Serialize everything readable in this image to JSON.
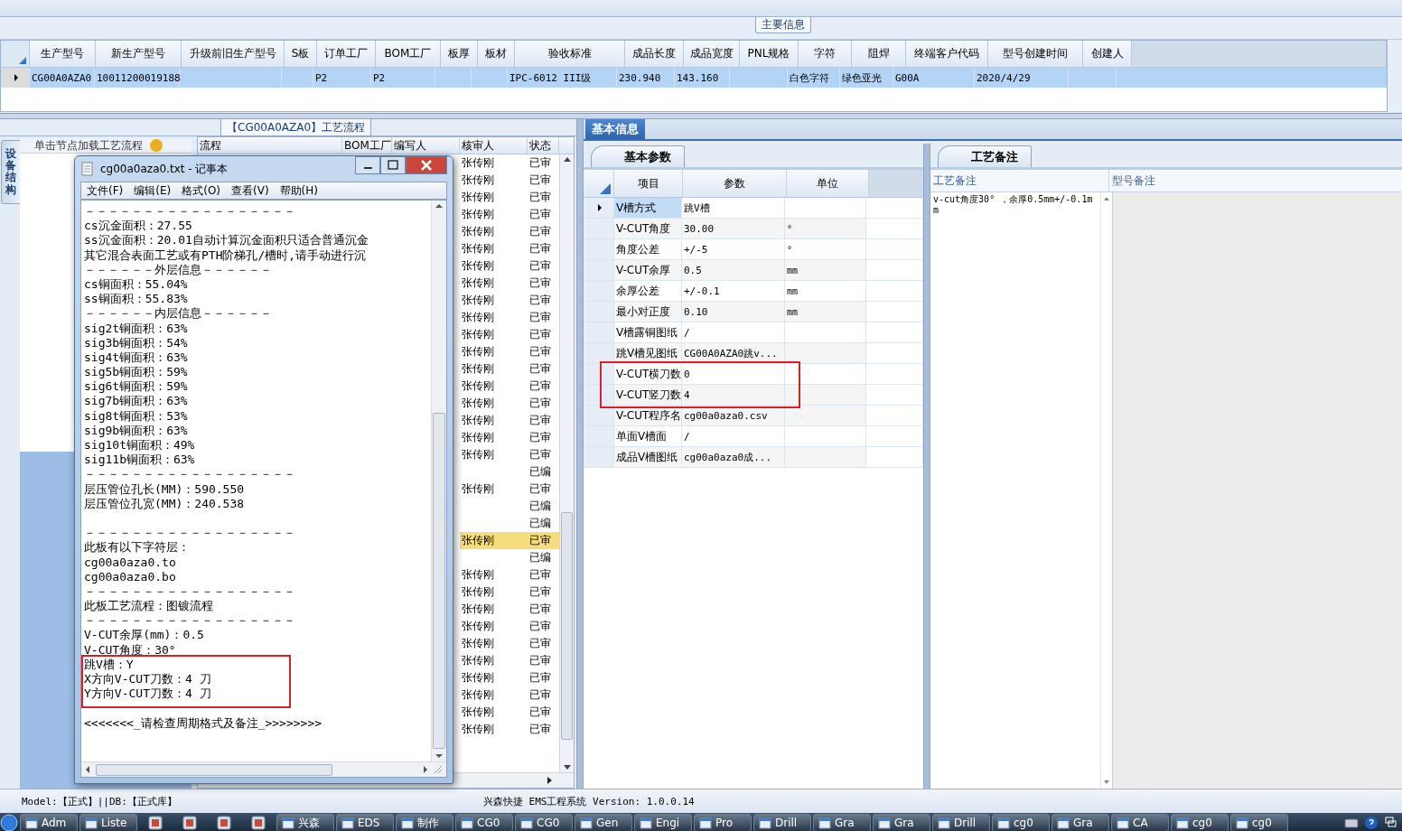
{
  "main_info": {
    "title": "主要信息",
    "columns": [
      "生产型号",
      "新生产型号",
      "升级前旧生产型号",
      "S板",
      "订单工厂",
      "BOM工厂",
      "板厚",
      "板材",
      "验收标准",
      "成品长度",
      "成品宽度",
      "PNL规格",
      "字符",
      "阻焊",
      "终端客户代码",
      "型号创建时间",
      "创建人"
    ],
    "rows": [
      {
        "selected": true,
        "cells": [
          "CG00A0AZA0",
          "10011200019188",
          null,
          null,
          "P2",
          "P2",
          null,
          null,
          "IPC-6012 III级",
          "230.940",
          "143.160",
          null,
          "白色字符",
          "绿色亚光",
          "G00A",
          "2020/4/29",
          null
        ]
      }
    ]
  },
  "flow_panel": {
    "title": "【CG00A0AZA0】工艺流程",
    "side_tab": "设备结构",
    "tree_hint": "单击节点加载工艺流程",
    "columns": [
      "流程",
      "BOM工厂",
      "编写人",
      "核审人",
      "状态"
    ],
    "rows": [
      {
        "reviewer": "张传刚",
        "status": "已审",
        "selected": false
      },
      {
        "reviewer": "张传刚",
        "status": "已审",
        "selected": false
      },
      {
        "reviewer": "张传刚",
        "status": "已审",
        "selected": false
      },
      {
        "reviewer": "张传刚",
        "status": "已审",
        "selected": false
      },
      {
        "reviewer": "张传刚",
        "status": "已审",
        "selected": false
      },
      {
        "reviewer": "张传刚",
        "status": "已审",
        "selected": false
      },
      {
        "reviewer": "张传刚",
        "status": "已审",
        "selected": false
      },
      {
        "reviewer": "张传刚",
        "status": "已审",
        "selected": false
      },
      {
        "reviewer": "张传刚",
        "status": "已审",
        "selected": false
      },
      {
        "reviewer": "张传刚",
        "status": "已审",
        "selected": false
      },
      {
        "reviewer": "张传刚",
        "status": "已审",
        "selected": false
      },
      {
        "reviewer": "张传刚",
        "status": "已审",
        "selected": false
      },
      {
        "reviewer": "张传刚",
        "status": "已审",
        "selected": false
      },
      {
        "reviewer": "张传刚",
        "status": "已审",
        "selected": false
      },
      {
        "reviewer": "张传刚",
        "status": "已审",
        "selected": false
      },
      {
        "reviewer": "张传刚",
        "status": "已审",
        "selected": false
      },
      {
        "reviewer": "张传刚",
        "status": "已审",
        "selected": false
      },
      {
        "reviewer": "张传刚",
        "status": "已审",
        "selected": false
      },
      {
        "status": "已编",
        "selected": false
      },
      {
        "reviewer": "张传刚",
        "status": "已审",
        "selected": false
      },
      {
        "status": "已编",
        "selected": false
      },
      {
        "status": "已编",
        "selected": false
      },
      {
        "reviewer": "张传刚",
        "status": "已审",
        "selected": true
      },
      {
        "status": "已编",
        "selected": false
      },
      {
        "reviewer": "张传刚",
        "status": "已审",
        "selected": false
      },
      {
        "reviewer": "张传刚",
        "status": "已审",
        "selected": false
      },
      {
        "reviewer": "张传刚",
        "status": "已审",
        "selected": false
      },
      {
        "reviewer": "张传刚",
        "status": "已审",
        "selected": false
      },
      {
        "reviewer": "张传刚",
        "status": "已审",
        "selected": false
      },
      {
        "reviewer": "张传刚",
        "status": "已审",
        "selected": false
      },
      {
        "reviewer": "张传刚",
        "status": "已审",
        "selected": false
      },
      {
        "reviewer": "张传刚",
        "status": "已审",
        "selected": false
      },
      {
        "reviewer": "张传刚",
        "status": "已审",
        "selected": false
      },
      {
        "reviewer": "张传刚",
        "status": "已审",
        "selected": false
      }
    ]
  },
  "notepad": {
    "title": "cg00a0aza0.txt - 记事本",
    "menu": [
      "文件(F)",
      "编辑(E)",
      "格式(O)",
      "查看(V)",
      "帮助(H)"
    ],
    "lines": [
      {
        "kind": "text",
        "text": "－－－－－－－－－－－－－－－－－－",
        "highlighted": false
      },
      {
        "kind": "text",
        "text": "cs沉金面积：27.55",
        "highlighted": false
      },
      {
        "kind": "text",
        "text": "ss沉金面积：20.01自动计算沉金面积只适合普通沉金",
        "highlighted": false
      },
      {
        "kind": "text",
        "text": "其它混合表面工艺或有PTH阶梯孔/槽时,请手动进行沉",
        "highlighted": false
      },
      {
        "kind": "text",
        "text": "－－－－－－外层信息－－－－－－",
        "highlighted": false
      },
      {
        "kind": "text",
        "text": "cs铜面积：55.04%",
        "highlighted": false
      },
      {
        "kind": "text",
        "text": "ss铜面积：55.83%",
        "highlighted": false
      },
      {
        "kind": "text",
        "text": "－－－－－－内层信息－－－－－－",
        "highlighted": false
      },
      {
        "kind": "text",
        "text": "sig2t铜面积：63%",
        "highlighted": false
      },
      {
        "kind": "text",
        "text": "sig3b铜面积：54%",
        "highlighted": false
      },
      {
        "kind": "text",
        "text": "sig4t铜面积：63%",
        "highlighted": false
      },
      {
        "kind": "text",
        "text": "sig5b铜面积：59%",
        "highlighted": false
      },
      {
        "kind": "text",
        "text": "sig6t铜面积：59%",
        "highlighted": false
      },
      {
        "kind": "text",
        "text": "sig7b铜面积：63%",
        "highlighted": false
      },
      {
        "kind": "text",
        "text": "sig8t铜面积：53%",
        "highlighted": false
      },
      {
        "kind": "text",
        "text": "sig9b铜面积：63%",
        "highlighted": false
      },
      {
        "kind": "text",
        "text": "sig10t铜面积：49%",
        "highlighted": false
      },
      {
        "kind": "text",
        "text": "sig11b铜面积：63%",
        "highlighted": false
      },
      {
        "kind": "text",
        "text": "－－－－－－－－－－－－－－－－－－",
        "highlighted": false
      },
      {
        "kind": "text",
        "text": "层压管位孔长(MM)：590.550",
        "highlighted": false
      },
      {
        "kind": "text",
        "text": "层压管位孔宽(MM)：240.538",
        "highlighted": false
      },
      {
        "kind": "blank"
      },
      {
        "kind": "text",
        "text": "－－－－－－－－－－－－－－－－－－",
        "highlighted": false
      },
      {
        "kind": "text",
        "text": "此板有以下字符层：",
        "highlighted": false
      },
      {
        "kind": "text",
        "text": "cg00a0aza0.to",
        "highlighted": false
      },
      {
        "kind": "text",
        "text": "cg00a0aza0.bo",
        "highlighted": false
      },
      {
        "kind": "text",
        "text": "－－－－－－－－－－－－－－－－－－",
        "highlighted": false
      },
      {
        "kind": "text",
        "text": "此板工艺流程：图镀流程",
        "highlighted": false
      },
      {
        "kind": "text",
        "text": "－－－－－－－－－－－－－－－－－－",
        "highlighted": false
      },
      {
        "kind": "text",
        "text": "V-CUT余厚(mm)：0.5",
        "highlighted": false
      },
      {
        "kind": "text",
        "text": "V-CUT角度：30°",
        "highlighted": false
      },
      {
        "kind": "text",
        "text": "跳V槽：Y",
        "highlighted": true
      },
      {
        "kind": "text",
        "text": "X方向V-CUT刀数：4 刀",
        "highlighted": true
      },
      {
        "kind": "text",
        "text": "Y方向V-CUT刀数：4 刀",
        "highlighted": true
      },
      {
        "kind": "blank"
      },
      {
        "kind": "text",
        "text": "<<<<<<<_请检查周期格式及备注_>>>>>>>>",
        "highlighted": false
      }
    ]
  },
  "basic_info": {
    "tab": "基本信息",
    "params_tab": "基本参数",
    "columns": [
      "项目",
      "参数",
      "单位"
    ],
    "rows": [
      {
        "item": "V槽方式",
        "value": "跳V槽",
        "selected": true,
        "highlighted": false
      },
      {
        "item": "V-CUT角度",
        "value": "30.00",
        "unit": "°",
        "selected": false,
        "highlighted": false
      },
      {
        "item": "角度公差",
        "value": "+/-5",
        "unit": "°",
        "selected": false,
        "highlighted": false
      },
      {
        "item": "V-CUT余厚",
        "value": "0.5",
        "unit": "mm",
        "selected": false,
        "highlighted": false
      },
      {
        "item": "余厚公差",
        "value": "+/-0.1",
        "unit": "mm",
        "selected": false,
        "highlighted": false
      },
      {
        "item": "最小对正度",
        "value": "0.10",
        "unit": "mm",
        "selected": false,
        "highlighted": false
      },
      {
        "item": "V槽露铜图纸",
        "value": "/",
        "selected": false,
        "highlighted": false
      },
      {
        "item": "跳V槽见图纸",
        "value": "CG00A0AZA0跳v...",
        "selected": false,
        "highlighted": false
      },
      {
        "item": "V-CUT横刀数",
        "value": "0",
        "selected": false,
        "highlighted": true
      },
      {
        "item": "V-CUT竖刀数",
        "value": "4",
        "selected": false,
        "highlighted": true
      },
      {
        "item": "V-CUT程序名",
        "value": "cg00a0aza0.csv",
        "selected": false,
        "highlighted": false
      },
      {
        "item": "单面V槽面",
        "value": "/",
        "selected": false,
        "highlighted": false
      },
      {
        "item": "成品V槽图纸",
        "value": "cg00a0aza0成...",
        "selected": false,
        "highlighted": false
      }
    ],
    "remarks_tab": "工艺备注",
    "remarks_columns": [
      "工艺备注",
      "型号备注"
    ],
    "remarks_text": "v-cut角度30° ，余厚0.5mm+/-0.1mm"
  },
  "status_bar": {
    "left": "Model:【正式】||DB:【正式库】",
    "center": "兴森快捷 EMS工程系统 Version: 1.0.0.14"
  },
  "taskbar": {
    "items": [
      {
        "kind": "button",
        "label": "Adm"
      },
      {
        "kind": "button",
        "label": "Liste"
      },
      {
        "kind": "icon"
      },
      {
        "kind": "icon"
      },
      {
        "kind": "icon"
      },
      {
        "kind": "icon"
      },
      {
        "kind": "button",
        "label": "兴森"
      },
      {
        "kind": "button",
        "label": "EDS"
      },
      {
        "kind": "button",
        "label": "制作"
      },
      {
        "kind": "button",
        "label": "CG0"
      },
      {
        "kind": "button",
        "label": "CG0"
      },
      {
        "kind": "button",
        "label": "Gen"
      },
      {
        "kind": "button",
        "label": "Engi"
      },
      {
        "kind": "button",
        "label": "Pro"
      },
      {
        "kind": "button",
        "label": "Drill"
      },
      {
        "kind": "button",
        "label": "Gra"
      },
      {
        "kind": "button",
        "label": "Gra"
      },
      {
        "kind": "button",
        "label": "Drill"
      },
      {
        "kind": "button",
        "label": "cg0"
      },
      {
        "kind": "button",
        "label": "Gra"
      },
      {
        "kind": "button",
        "label": "CA"
      },
      {
        "kind": "button",
        "label": "cg0"
      },
      {
        "kind": "button",
        "label": "cg0"
      }
    ]
  }
}
